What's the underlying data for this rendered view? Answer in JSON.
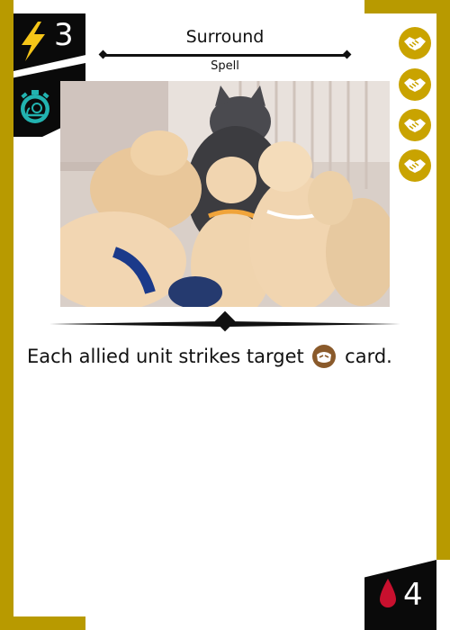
{
  "card": {
    "title": "Surround",
    "type": "Spell",
    "cost": "3",
    "life": "4",
    "rules_before": "Each allied unit strikes target",
    "rules_after": "card."
  },
  "icons": {
    "cost": "lightning-bolt-icon",
    "speed": "snail-stopwatch-icon",
    "coins": [
      "handshake-icon",
      "handshake-icon",
      "handshake-icon",
      "handshake-icon"
    ],
    "target": "enemy-target-icon",
    "life": "blood-drop-icon"
  },
  "colors": {
    "frame_gold": "#b89a00",
    "badge_black": "#0a0a0a",
    "bolt_yellow": "#f5c518",
    "snail_teal": "#22b3b0",
    "coin_gold": "#c9a300",
    "drop_red": "#c8102e",
    "target_brown": "#8a5a2b"
  }
}
